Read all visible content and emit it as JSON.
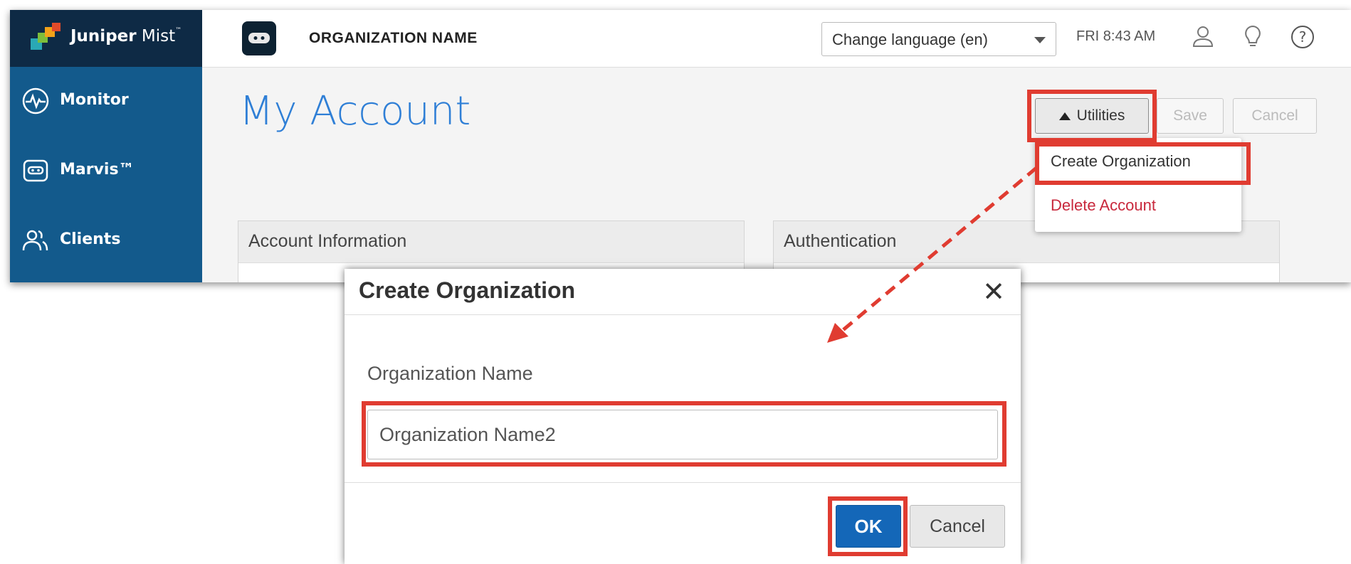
{
  "app": {
    "logo": {
      "brand": "Juniper",
      "product": "Mist",
      "tm": "™"
    },
    "sidebar": {
      "items": [
        {
          "label": "Monitor",
          "icon": "monitor-pulse-icon"
        },
        {
          "label": "Marvis™",
          "icon": "marvis-icon"
        },
        {
          "label": "Clients",
          "icon": "clients-icon"
        }
      ]
    },
    "topbar": {
      "org_name": "ORGANIZATION NAME",
      "language": "Change language (en)",
      "clock": "FRI 8:43 AM",
      "icons": [
        "user-icon",
        "lightbulb-icon",
        "help-icon"
      ]
    },
    "page_title": "My Account",
    "toolbar": {
      "utilities_label": "Utilities",
      "save_label": "Save",
      "cancel_label": "Cancel"
    },
    "utilities_menu": {
      "items": [
        {
          "label": "Create Organization",
          "color": "#333333"
        },
        {
          "label": "Delete Account",
          "color": "#c8283c"
        }
      ]
    },
    "panels": [
      {
        "title": "Account Information"
      },
      {
        "title": "Authentication"
      }
    ]
  },
  "dialog": {
    "title": "Create Organization",
    "field_label": "Organization Name",
    "field_value": "Organization Name2",
    "ok_label": "OK",
    "cancel_label": "Cancel"
  },
  "colors": {
    "sidebar": "#135a8c",
    "logo_bg": "#0e2a45",
    "title_blue": "#2f7fd6",
    "highlight_red": "#e03c31",
    "ok_blue": "#1467b8"
  }
}
